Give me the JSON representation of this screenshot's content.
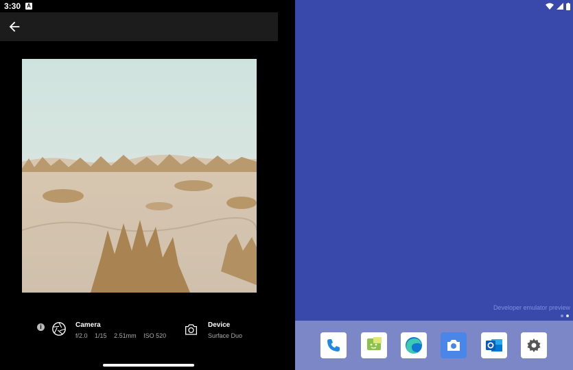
{
  "status_bar": {
    "time": "3:30",
    "notification_icon_letter": "A"
  },
  "app_bar": {
    "back_icon": "arrow-left-icon"
  },
  "photo": {
    "subject": "sand-dunes-photo"
  },
  "camera_info": {
    "title": "Camera",
    "aperture": "f/2.0",
    "shutter": "1/15",
    "focal_length": "2.51mm",
    "iso": "ISO 520"
  },
  "device_info": {
    "title": "Device",
    "model": "Surface Duo"
  },
  "info_icon_glyph": "i",
  "home_screen": {
    "emulator_label": "Developer emulator preview",
    "page_indicator": {
      "pages": 2,
      "current": 2
    },
    "dock_apps": [
      "phone-icon",
      "messages-icon",
      "edge-icon",
      "camera-icon",
      "outlook-icon",
      "settings-icon"
    ]
  },
  "colors": {
    "home_background": "#3949ab",
    "dock_background": "#7c87c7",
    "app_bar": "#1c1c1c"
  }
}
